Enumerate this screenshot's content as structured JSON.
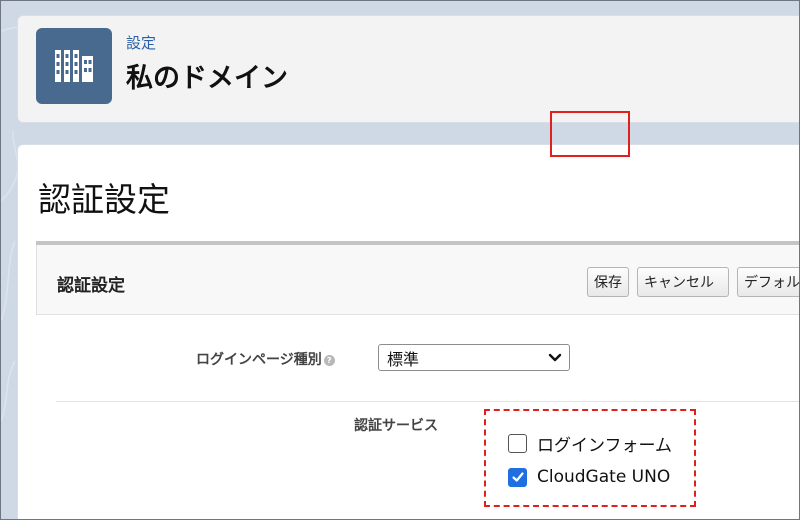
{
  "header": {
    "breadcrumb": "設定",
    "title": "私のドメイン",
    "icon": "building-icon"
  },
  "main": {
    "section_title": "認証設定"
  },
  "panel": {
    "title": "認証設定",
    "buttons": {
      "save": "保存",
      "cancel": "キャンセル",
      "default": "デフォルト"
    },
    "login_page_type": {
      "label": "ログインページ種別",
      "value": "標準"
    },
    "auth_service": {
      "label": "認証サービス",
      "options": [
        {
          "label": "ログインフォーム",
          "checked": false
        },
        {
          "label": "CloudGate UNO",
          "checked": true
        }
      ]
    }
  },
  "colors": {
    "accent": "#1f6fe0",
    "highlight": "#e0201c",
    "icon_bg": "#486a8f"
  }
}
